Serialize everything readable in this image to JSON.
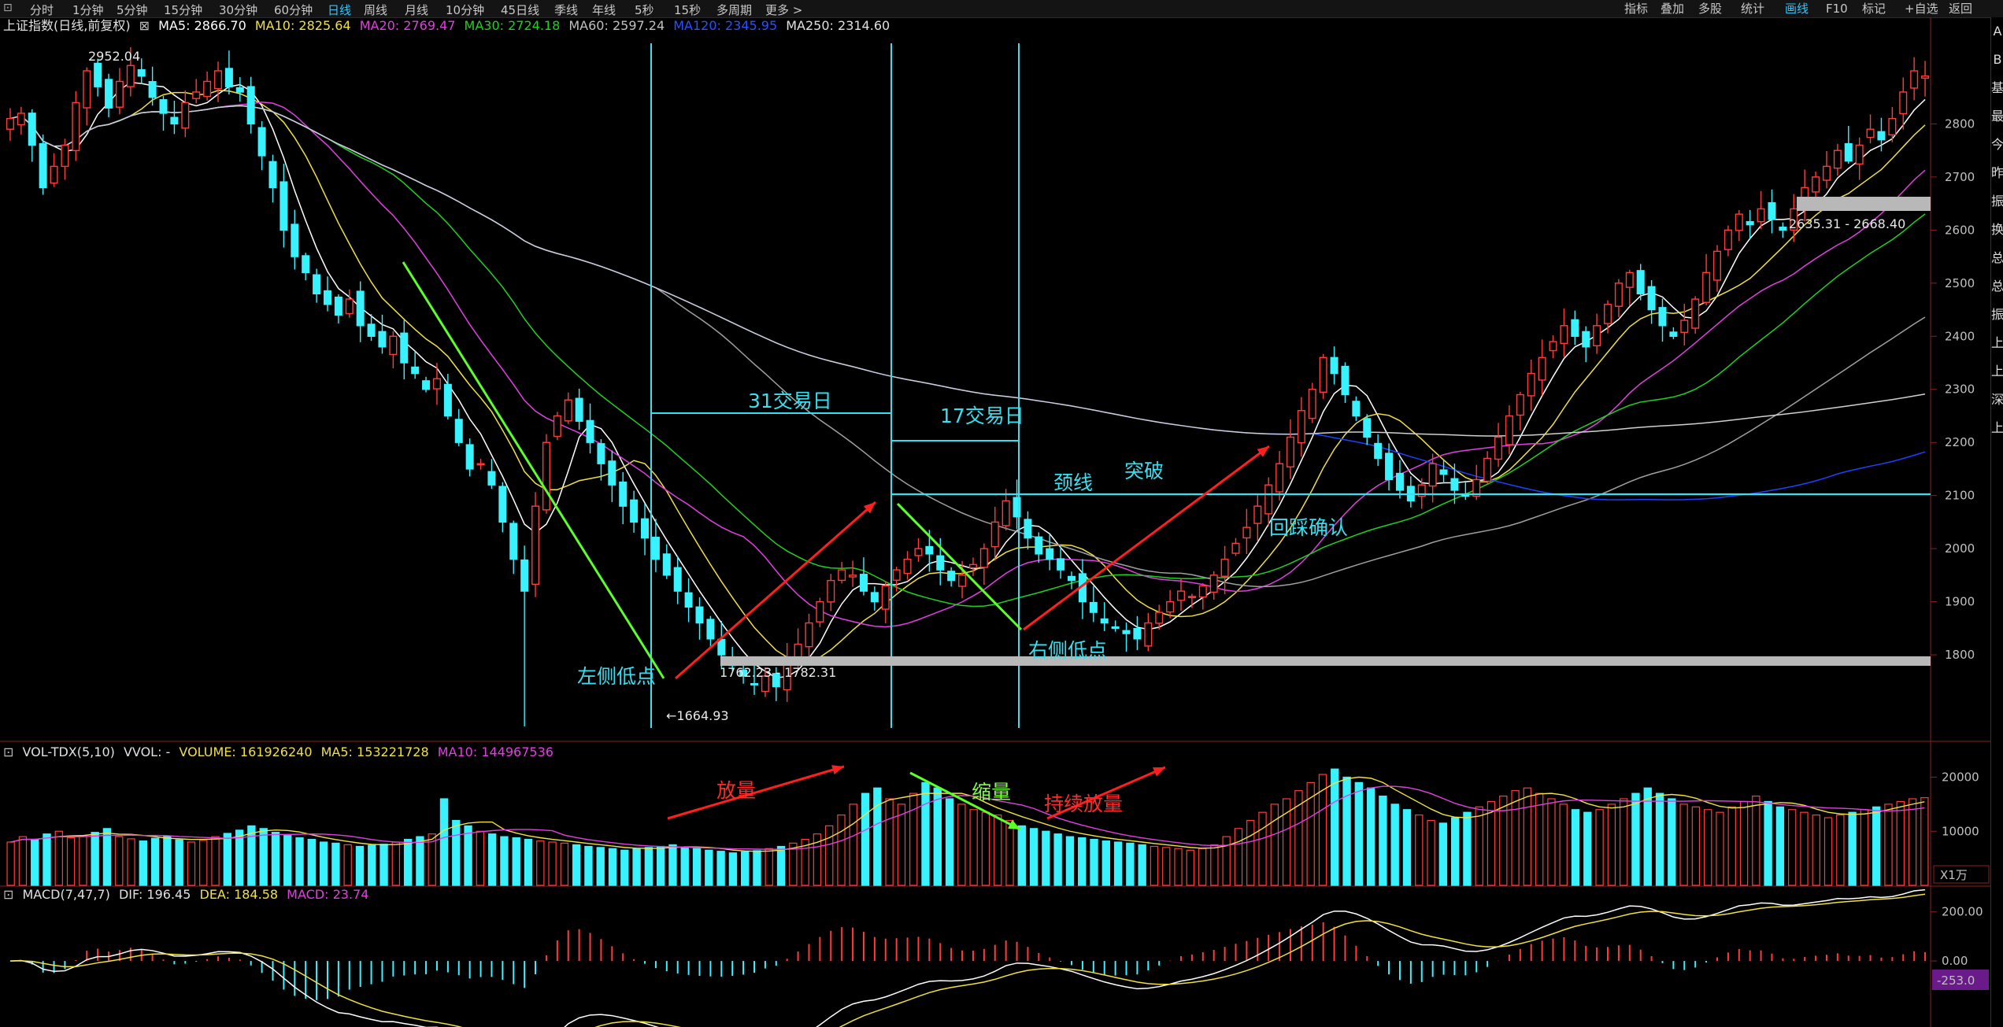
{
  "toolbar": {
    "periods": [
      "分时",
      "1分钟",
      "5分钟",
      "15分钟",
      "30分钟",
      "60分钟",
      "日线",
      "周线",
      "月线",
      "10分钟",
      "45日线",
      "季线",
      "年线",
      "5秒",
      "15秒",
      "多周期",
      "更多 >"
    ],
    "active_period": "日线",
    "right_buttons": [
      "指标",
      "叠加",
      "多股",
      "统计",
      "画线",
      "F10",
      "标记",
      "+自选",
      "返回"
    ],
    "active_right": "画线"
  },
  "colors": {
    "up": "#ff3b3b",
    "down": "#38f2ff",
    "ma5": "#ffffff",
    "ma10": "#f0e040",
    "ma20": "#e040e0",
    "ma30": "#20d020",
    "ma60": "#a0a0a0",
    "ma120": "#2040ff",
    "ma250": "#d0d0d0",
    "cyan": "#35e0f0"
  },
  "legend_main": {
    "name": "上证指数(日线,前复权)",
    "ma5": "MA5: 2866.70",
    "ma10": "MA10: 2825.64",
    "ma20": "MA20: 2769.47",
    "ma30": "MA30: 2724.18",
    "ma60": "MA60: 2597.24",
    "ma120": "MA120: 2345.95",
    "ma250": "MA250: 2314.60"
  },
  "legend_vol": {
    "name": "VOL-TDX(5,10)",
    "vvol": "VVOL: -",
    "volume": "VOLUME: 161926240",
    "ma5": "MA5: 153221728",
    "ma10": "MA10: 144967536"
  },
  "legend_macd": {
    "name": "MACD(7,47,7)",
    "dif": "DIF: 196.45",
    "dea": "DEA: 184.58",
    "macd": "MACD: 23.74"
  },
  "annotations": {
    "high_label": "2952.04",
    "low_label": "←1664.93",
    "left_low": "左侧低点",
    "right_low": "右侧低点",
    "days31": "31交易日",
    "days17": "17交易日",
    "neckline": "颈线",
    "breakout": "突破",
    "retest": "回踩确认",
    "range1": "1762.23 - 1782.31",
    "range2": "2635.31 - 2668.40",
    "vol_up": "放量",
    "vol_down": "缩量",
    "vol_cont": "持续放量",
    "vol_unit": "X1万",
    "macd_low": "-253.0"
  },
  "side_strip": [
    "A",
    "B",
    "基",
    "最",
    "今",
    "昨",
    "振",
    "换",
    "总",
    "总",
    "振",
    "上",
    "上",
    "深",
    "上"
  ],
  "chart_data": [
    {
      "type": "candlestick",
      "title": "上证指数(日线,前复权)",
      "y_ticks": [
        1800,
        1900,
        2000,
        2100,
        2200,
        2300,
        2400,
        2500,
        2600,
        2700,
        2800
      ],
      "ylim": [
        1640,
        2980
      ],
      "key_levels": {
        "high": 2952.04,
        "low": 1664.93,
        "neckline": 2100,
        "support_band": [
          1762.23,
          1782.31
        ],
        "upper_band": [
          2635.31,
          2668.4
        ]
      },
      "ohlc_close_series": [
        2810,
        2820,
        2760,
        2680,
        2720,
        2760,
        2840,
        2900,
        2870,
        2830,
        2880,
        2910,
        2890,
        2850,
        2820,
        2800,
        2840,
        2860,
        2880,
        2900,
        2870,
        2860,
        2800,
        2740,
        2680,
        2600,
        2550,
        2520,
        2480,
        2460,
        2440,
        2470,
        2420,
        2400,
        2380,
        2400,
        2350,
        2330,
        2300,
        2320,
        2250,
        2200,
        2150,
        2160,
        2120,
        2050,
        1980,
        1920,
        2080,
        2200,
        2250,
        2280,
        2240,
        2200,
        2160,
        2120,
        2080,
        2050,
        2020,
        1980,
        1950,
        1920,
        1890,
        1860,
        1830,
        1800,
        1780,
        1760,
        1745,
        1760,
        1740,
        1790,
        1820,
        1860,
        1900,
        1940,
        1960,
        1950,
        1920,
        1900,
        1930,
        1960,
        1980,
        2000,
        1990,
        1960,
        1940,
        1950,
        1970,
        2000,
        2050,
        2090,
        2060,
        2020,
        1990,
        1980,
        1960,
        1940,
        1900,
        1880,
        1860,
        1850,
        1840,
        1830,
        1860,
        1880,
        1900,
        1920,
        1910,
        1930,
        1950,
        1980,
        2010,
        2040,
        2080,
        2120,
        2160,
        2210,
        2260,
        2300,
        2360,
        2330,
        2290,
        2250,
        2210,
        2170,
        2130,
        2110,
        2090,
        2120,
        2160,
        2140,
        2110,
        2100,
        2130,
        2170,
        2210,
        2250,
        2290,
        2330,
        2360,
        2390,
        2420,
        2400,
        2380,
        2420,
        2460,
        2500,
        2520,
        2480,
        2450,
        2420,
        2400,
        2430,
        2470,
        2520,
        2560,
        2600,
        2630,
        2610,
        2640,
        2620,
        2600,
        2640,
        2680,
        2700,
        2720,
        2750,
        2730,
        2760,
        2790,
        2770,
        2810,
        2860,
        2900,
        2890
      ]
    },
    {
      "type": "bar",
      "title": "VOL-TDX(5,10)",
      "y_ticks": [
        10000,
        20000
      ],
      "unit": "X1万",
      "values": [
        8000,
        9000,
        8500,
        9500,
        10000,
        8800,
        9200,
        9800,
        10500,
        9000,
        8600,
        8200,
        8700,
        9100,
        8400,
        8000,
        8300,
        9000,
        9600,
        10200,
        11000,
        10500,
        9800,
        9200,
        8800,
        8500,
        8000,
        7800,
        7500,
        7200,
        7400,
        7600,
        8000,
        8500,
        9000,
        9500,
        16000,
        12000,
        11000,
        10000,
        9500,
        9000,
        8800,
        8500,
        8200,
        8000,
        7800,
        7500,
        7200,
        7000,
        6800,
        6500,
        6800,
        7000,
        7200,
        7500,
        7000,
        6800,
        6500,
        6300,
        6000,
        6200,
        6400,
        6800,
        7200,
        7800,
        8500,
        9500,
        11000,
        13000,
        15000,
        17000,
        18000,
        16000,
        15000,
        17000,
        19000,
        18000,
        16000,
        15000,
        14000,
        13500,
        13000,
        12000,
        11000,
        10500,
        10000,
        9500,
        9000,
        8800,
        8500,
        8200,
        8000,
        7800,
        7500,
        7200,
        7000,
        6800,
        6500,
        6800,
        7500,
        9000,
        10500,
        12000,
        13500,
        15000,
        16000,
        17500,
        19000,
        20500,
        21500,
        20000,
        19000,
        18000,
        16500,
        15000,
        14000,
        13000,
        12000,
        11500,
        12500,
        13500,
        14500,
        15500,
        16500,
        17500,
        18000,
        17000,
        16000,
        15000,
        14000,
        13500,
        14000,
        15000,
        16000,
        17000,
        18000,
        17000,
        16000,
        15000,
        14500,
        14000,
        13500,
        14500,
        15500,
        16500,
        15500,
        14500,
        14000,
        13500,
        13000,
        12500,
        13000,
        13500,
        14000,
        14500,
        15000,
        15500,
        16000,
        16200
      ]
    },
    {
      "type": "bar",
      "title": "MACD(7,47,7)",
      "y_ticks": [
        0.0,
        200.0
      ],
      "ylim": [
        -253.0,
        260.0
      ]
    }
  ]
}
